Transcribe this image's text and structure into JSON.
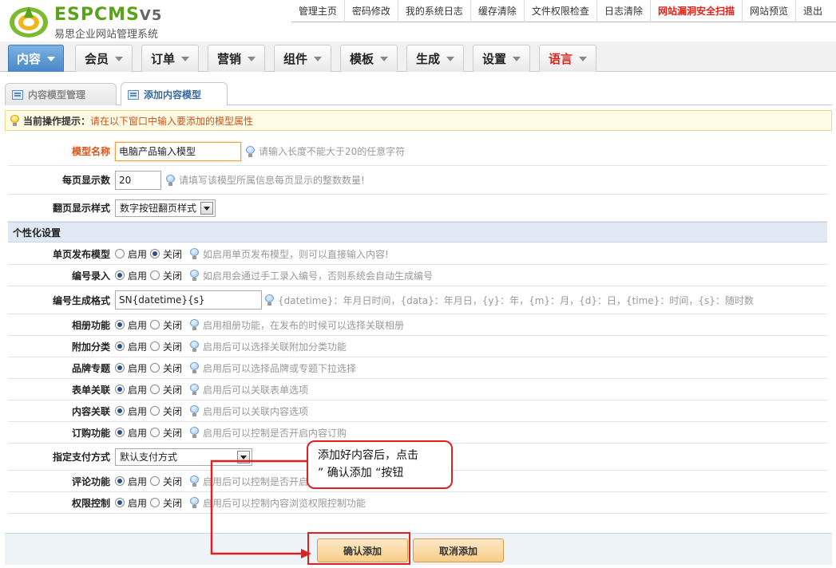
{
  "app": {
    "logo_text": "ESPCMS",
    "logo_version": "V5",
    "logo_subtitle": "易思企业网站管理系统"
  },
  "topnav": [
    {
      "label": "管理主页"
    },
    {
      "label": "密码修改"
    },
    {
      "label": "我的系统日志"
    },
    {
      "label": "缓存清除"
    },
    {
      "label": "文件权限检查"
    },
    {
      "label": "日志清除"
    },
    {
      "label": "网站漏洞安全扫描",
      "highlight": true
    },
    {
      "label": "网站预览"
    },
    {
      "label": "退出"
    }
  ],
  "mainnav": [
    {
      "label": "内容",
      "active": true
    },
    {
      "label": "会员"
    },
    {
      "label": "订单"
    },
    {
      "label": "营销"
    },
    {
      "label": "组件"
    },
    {
      "label": "模板"
    },
    {
      "label": "生成"
    },
    {
      "label": "设置"
    },
    {
      "label": "语言",
      "color": "#e2231a"
    }
  ],
  "subtabs": [
    {
      "label": "内容模型管理"
    },
    {
      "label": "添加内容模型",
      "active": true
    }
  ],
  "hint": {
    "label": "当前操作提示：",
    "text": "请在以下窗口中输入要添加的模型属性"
  },
  "form": {
    "model_name": {
      "label": "模型名称",
      "value": "电脑产品输入模型",
      "help": "请输入长度不能大于20的任意字符"
    },
    "page_size": {
      "label": "每页显示数",
      "value": "20",
      "help": "请填写该模型所属信息每页显示的整数数量!"
    },
    "page_style": {
      "label": "翻页显示样式",
      "value": "数字按钮翻页样式"
    },
    "section_title": "个性化设置",
    "single_page": {
      "label": "单页发布模型",
      "on": "启用",
      "off": "关闭",
      "selected": "off",
      "help": "如启用单页发布模型，则可以直接输入内容!"
    },
    "code_input": {
      "label": "编号录入",
      "on": "启用",
      "off": "关闭",
      "selected": "on",
      "help": "如启用会通过手工录入编号，否则系统会自动生成编号"
    },
    "code_format": {
      "label": "编号生成格式",
      "value": "SN{datetime}{s}",
      "help": "{datetime}：年月日时间，{data}：年月日，{y}：年，{m}：月，{d}：日，{time}：时间，{s}：随时数"
    },
    "album": {
      "label": "相册功能",
      "on": "启用",
      "off": "关闭",
      "selected": "on",
      "help": "启用相册功能，在发布的时候可以选择关联相册"
    },
    "extra_category": {
      "label": "附加分类",
      "on": "启用",
      "off": "关闭",
      "selected": "on",
      "help": "启用后可以选择关联附加分类功能"
    },
    "brand": {
      "label": "品牌专题",
      "on": "启用",
      "off": "关闭",
      "selected": "on",
      "help": "启用后可以选择品牌或专题下拉选择"
    },
    "form_link": {
      "label": "表单关联",
      "on": "启用",
      "off": "关闭",
      "selected": "on",
      "help": "启用后可以关联表单选项"
    },
    "content_link": {
      "label": "内容关联",
      "on": "启用",
      "off": "关闭",
      "selected": "on",
      "help": "启用后可以关联内容选项"
    },
    "order": {
      "label": "订购功能",
      "on": "启用",
      "off": "关闭",
      "selected": "on",
      "help": "启用后可以控制是否开启内容订购"
    },
    "payment": {
      "label": "指定支付方式",
      "value": "默认支付方式"
    },
    "comment": {
      "label": "评论功能",
      "on": "启用",
      "off": "关闭",
      "selected": "on",
      "help": "启用后可以控制是否开启"
    },
    "permission": {
      "label": "权限控制",
      "on": "启用",
      "off": "关闭",
      "selected": "on",
      "help": "启用后可以控制内容浏览权限控制功能"
    }
  },
  "buttons": {
    "confirm": "确认添加",
    "cancel": "取消添加"
  },
  "annotation": {
    "line1": "添加好内容后，点击",
    "line2": "” 确认添加 “按钮"
  },
  "colors": {
    "brand_green": "#5aa21a",
    "accent_blue": "#4a87c8",
    "warning_red": "#e2231a",
    "hint_orange": "#c8551a"
  }
}
